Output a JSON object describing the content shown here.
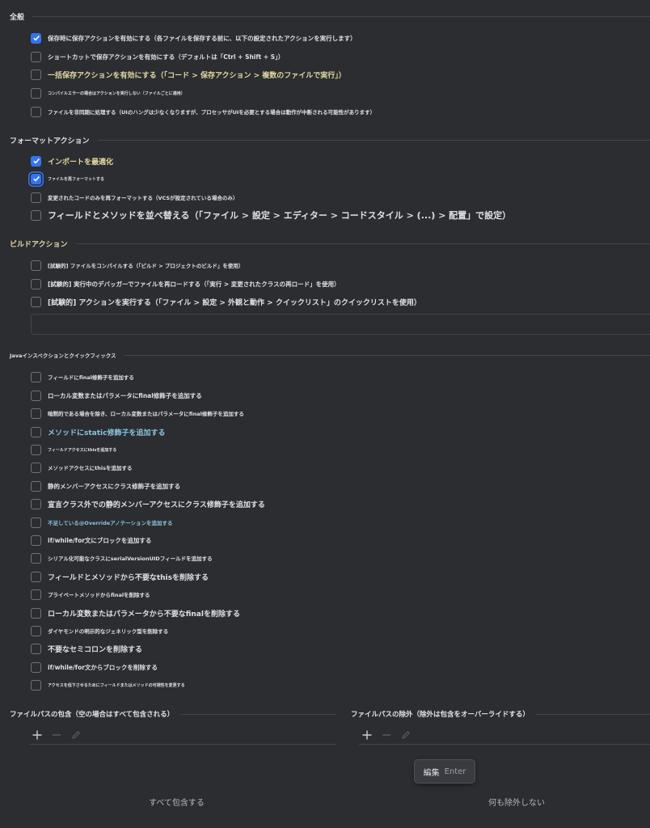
{
  "sections": {
    "general": "全般",
    "format": "フォーマットアクション",
    "build": "ビルドアクション",
    "java": "Javaインスペクションとクイックフィックス"
  },
  "general_items": [
    {
      "label": "保存時に保存アクションを有効にする（各ファイルを保存する前に、以下の設定されたアクションを実行します）",
      "checked": true
    },
    {
      "label": "ショートカットで保存アクションを有効にする（デフォルトは「Ctrl + Shift + S」）",
      "checked": false
    },
    {
      "label": "一括保存アクションを有効にする（「コード > 保存アクション > 複数のファイルで実行」）",
      "checked": false
    },
    {
      "label": "コンパイルエラーの場合はアクションを実行しない（ファイルごとに適用）",
      "checked": false
    },
    {
      "label": "ファイルを非同期に処理する（UIのハングは少なくなりますが、プロセッサがUIを必要とする場合は動作が中断される可能性があります）",
      "checked": false
    }
  ],
  "format_items": [
    {
      "label": "インポートを最適化",
      "checked": true
    },
    {
      "label": "ファイルを再フォーマットする",
      "checked": true
    },
    {
      "label": "変更されたコードのみを再フォーマットする（VCSが設定されている場合のみ）",
      "checked": false
    },
    {
      "label": "フィールドとメソッドを並べ替える（「ファイル > 設定 > エディター > コードスタイル > (...) > 配置」で設定）",
      "checked": false
    }
  ],
  "build_items": [
    {
      "label": "[試験的] ファイルをコンパイルする（「ビルド > プロジェクトのビルド」を使用）",
      "checked": false
    },
    {
      "label": "[試験的] 実行中のデバッガーでファイルを再ロードする（「実行 > 変更されたクラスの再ロード」を使用）",
      "checked": false
    },
    {
      "label": "[試験的] アクションを実行する（「ファイル > 設定 > 外観と動作 > クイックリスト」のクイックリストを使用）",
      "checked": false
    }
  ],
  "build_quicklist_value": "",
  "java_items": [
    {
      "label": "フィールドにfinal修飾子を追加する",
      "checked": false
    },
    {
      "label": "ローカル変数またはパラメータにfinal修飾子を追加する",
      "checked": false
    },
    {
      "label": "暗黙的である場合を除き、ローカル変数またはパラメータにfinal修飾子を追加する",
      "checked": false
    },
    {
      "label": "メソッドにstatic修飾子を追加する",
      "checked": false
    },
    {
      "label": "フィールドアクセスにthisを追加する",
      "checked": false
    },
    {
      "label": "メソッドアクセスにthisを追加する",
      "checked": false
    },
    {
      "label": "静的メンバーアクセスにクラス修飾子を追加する",
      "checked": false
    },
    {
      "label": "宣言クラス外での静的メンバーアクセスにクラス修飾子を追加する",
      "checked": false
    },
    {
      "label": "不足している@Overrideアノテーションを追加する",
      "checked": false
    },
    {
      "label": "if/while/for文にブロックを追加する",
      "checked": false
    },
    {
      "label": "シリアル化可能なクラスにserialVersionUIDフィールドを追加する",
      "checked": false
    },
    {
      "label": "フィールドとメソッドから不要なthisを削除する",
      "checked": false
    },
    {
      "label": "プライベートメソッドからfinalを削除する",
      "checked": false
    },
    {
      "label": "ローカル変数またはパラメータから不要なfinalを削除する",
      "checked": false
    },
    {
      "label": "ダイヤモンドの明示的なジェネリック型を削除する",
      "checked": false
    },
    {
      "label": "不要なセミコロンを削除する",
      "checked": false
    },
    {
      "label": "if/while/for文からブロックを削除する",
      "checked": false
    },
    {
      "label": "アクセスを低下させるためにフィールドまたはメソッドの可視性を変更する",
      "checked": false
    }
  ],
  "include_panel": {
    "title": "ファイルパスの包含（空の場合はすべて包含される）",
    "empty_text": "すべて包含する"
  },
  "exclude_panel": {
    "title": "ファイルパスの除外（除外は包含をオーバーライドする）",
    "empty_text": "何も除外しない"
  },
  "tooltip": {
    "action": "編集",
    "shortcut": "Enter"
  },
  "icons": {
    "add": "plus-icon",
    "remove": "minus-icon",
    "edit": "pencil-icon",
    "check": "checkmark-icon"
  },
  "colors": {
    "background": "#2b2d30",
    "accent": "#3574f0",
    "text": "#dfe1e5",
    "separator": "#43454a"
  }
}
